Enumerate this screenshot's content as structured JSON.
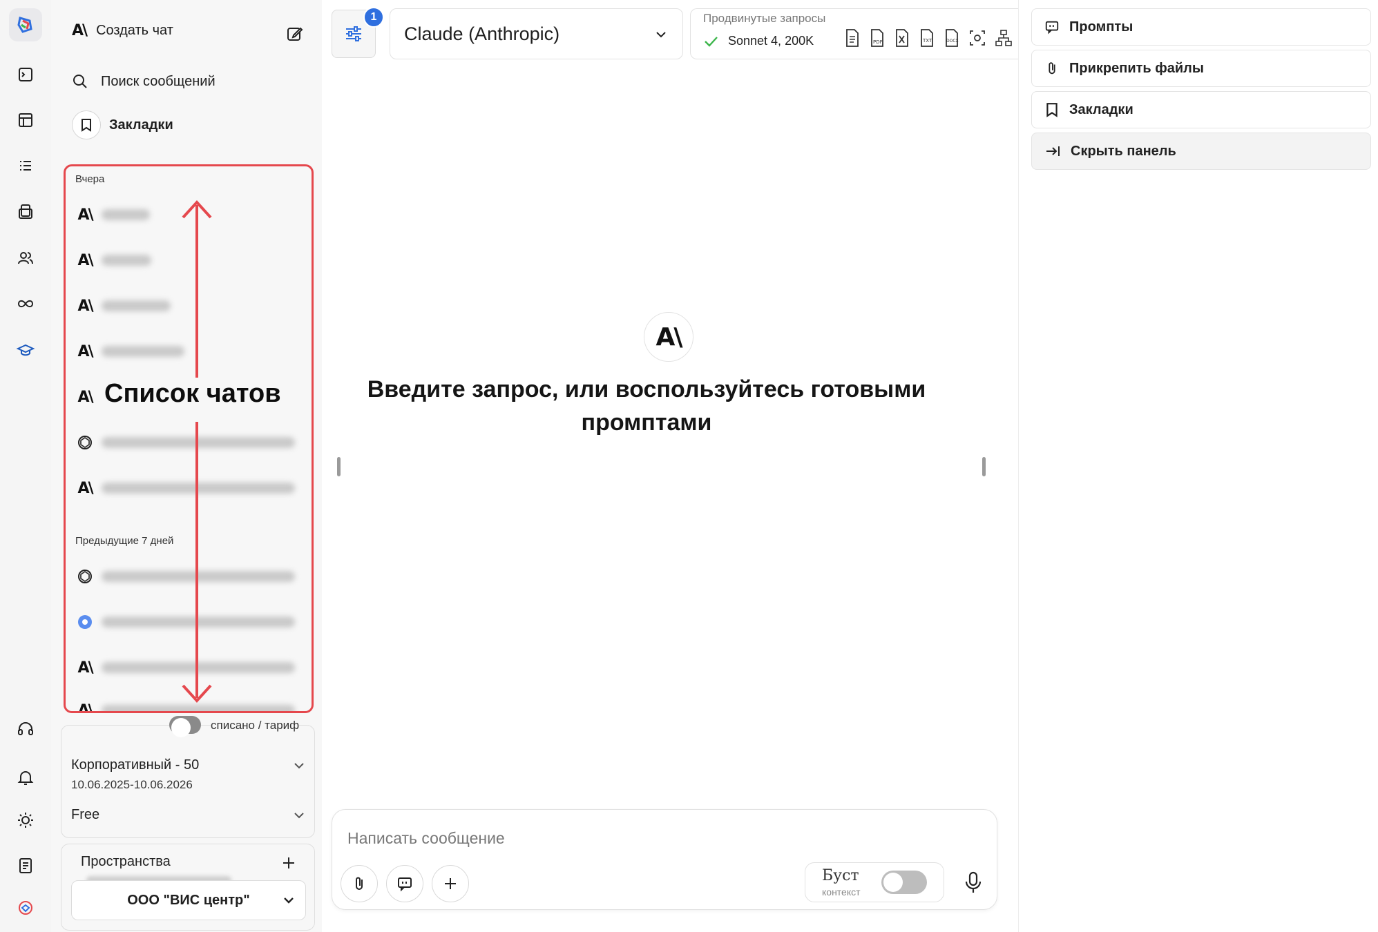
{
  "sidebar": {
    "create_chat": "Создать чат",
    "search": "Поиск сообщений",
    "bookmarks": "Закладки",
    "annotation": "Список чатов",
    "groups": [
      {
        "label": "Вчера",
        "items": [
          "anthropic",
          "anthropic",
          "anthropic",
          "anthropic",
          "anthropic",
          "openai",
          "anthropic"
        ]
      },
      {
        "label": "Предыдущие 7 дней",
        "items": [
          "openai",
          "gemini",
          "anthropic",
          "anthropic"
        ]
      }
    ],
    "tariff": {
      "toggle_label": "списано / тариф",
      "plan": "Корпоративный - 50",
      "dates": "10.06.2025-10.06.2026",
      "free": "Free"
    },
    "spaces": {
      "title": "Пространства",
      "selected": "ООО \"ВИС центр\""
    }
  },
  "header": {
    "badge": "1",
    "model": "Claude (Anthropic)",
    "advanced_label": "Продвинутые запросы",
    "advanced_value": "Sonnet 4, 200K"
  },
  "main": {
    "welcome": "Введите запрос, или воспользуйтесь готовыми промптами",
    "composer_placeholder": "Написать сообщение",
    "boost_label": "Буст",
    "boost_sub": "контекст"
  },
  "right_panel": {
    "items": [
      "Промпты",
      "Прикрепить файлы",
      "Закладки",
      "Скрыть панель"
    ]
  },
  "colors": {
    "accent": "#2f6fdf",
    "annotation": "#e5484d",
    "check": "#3bb54a"
  }
}
